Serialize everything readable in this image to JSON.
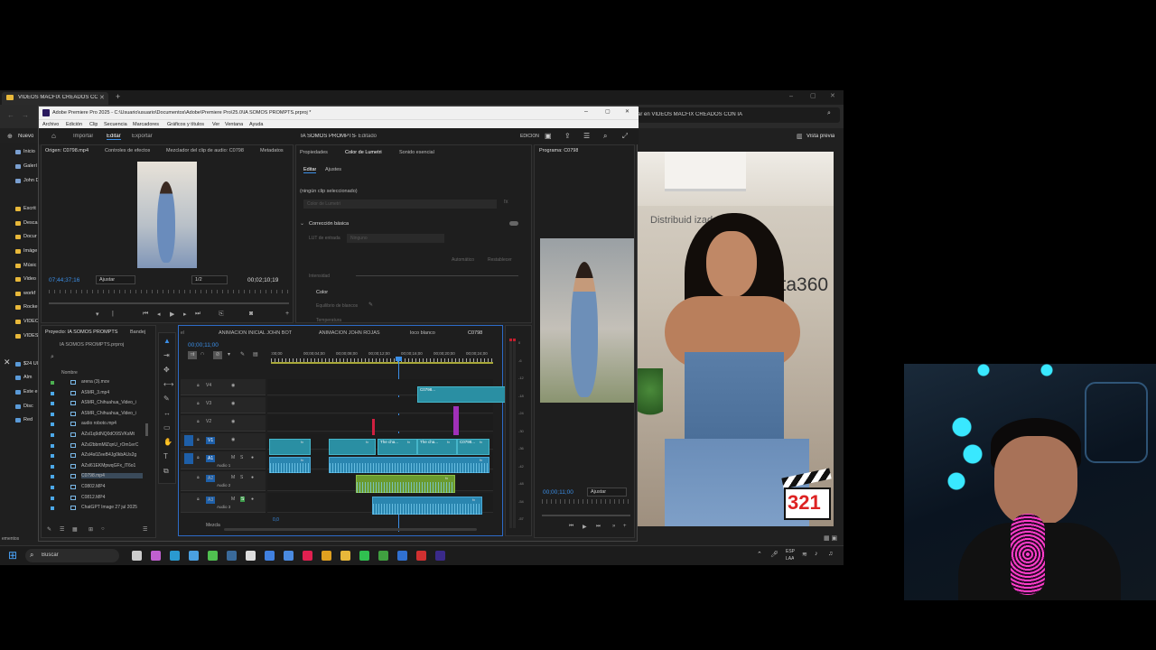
{
  "browser": {
    "tab_title": "VIDEOS MACFIX CREADOS CO",
    "search_text": "ar en VIDEOS MACFIX CREADOS CON IA",
    "preview_label": "Vista previa",
    "new_label": "Nuevo",
    "sidebar": [
      "Inicio",
      "Galerí",
      "John D",
      "Escrit",
      "Desca",
      "Docur",
      "Imáge",
      "Músic",
      "Video",
      "workf",
      "Rocke",
      "VIDEO",
      "VIDES",
      "$24 Ul",
      "Alm",
      "Este e",
      "Disc",
      "Red"
    ],
    "status_left": "ementos"
  },
  "premiere": {
    "window_title": "Adobe Premiere Pro 2025 - C:\\Usuario\\usuario\\Documentos\\Adobe\\Premiere Pro\\25.0\\IA SOMOS PROMPTS.prproj *",
    "menu": [
      "Archivo",
      "Edición",
      "Clip",
      "Secuencia",
      "Marcadores",
      "Gráficos y títulos",
      "Ver",
      "Ventana",
      "Ayuda"
    ],
    "header_tabs": [
      "Importar",
      "Editar",
      "Exportar"
    ],
    "project_title": "IA SOMOS PROMPTS",
    "project_status": "- Editado",
    "workspace_label": "EDICIÓN",
    "source": {
      "tabs": [
        "Origen: C0798.mp4",
        "Controles de efectos",
        "Mezclador del clip de audio: C0798",
        "Metadatos"
      ],
      "timecode": "07;44;37;16",
      "fit": "Ajustar",
      "ratio": "1/2",
      "duration": "00;02;10;19"
    },
    "lumetri": {
      "tabs": [
        "Propiedades",
        "Color de Lumetri",
        "Sonido esencial"
      ],
      "subtabs": [
        "Editar",
        "Ajustes"
      ],
      "no_clip": "(ningún clip seleccionado)",
      "dropdown": "Color de Lumetri",
      "section_basic": "Corrección básica",
      "lut_label": "LUT de entrada",
      "lut_value": "Ninguno",
      "auto": "Automático",
      "reset": "Restablecer",
      "intensity": "Intensidad",
      "color_section": "Color",
      "wb": "Equilibrio de blancos",
      "temp": "Temperatura"
    },
    "program": {
      "tab": "Programa: C0798",
      "timecode": "00;00;11;00",
      "fit": "Ajustar"
    },
    "project": {
      "tabs": [
        "Proyecto: IA SOMOS PROMPTS",
        "Bandej"
      ],
      "file": "IA SOMOS PROMPTS.prproj",
      "col": "Nombre",
      "items": [
        "arena (3).mov",
        "ASMR_3.mp4",
        "ASMR_Chihuahua_Video_i",
        "ASMR_Chihuahua_Video_i",
        "audio roboto.mp4",
        "AZsl1q9dNQ0dO9SVKsMt",
        "AZsl2bbmMlZqnU_rOm1erC",
        "AZsl4s0ZeeB4Jg0kbAUs2g",
        "AZsl61EKMpwqGFx_lT6o1",
        "C0798.mp4",
        "C0802.MP4",
        "C0812.MP4",
        "ChatGPT Image 27 jul 2025"
      ]
    },
    "timeline": {
      "tabs": [
        "ANIMACION INICIAL JOHN BOT",
        "ANIMACION JOHN ROJAS",
        "loco blanco",
        "C0798"
      ],
      "timecode": "00;00;11;00",
      "ruler": [
        ":00;00",
        "00;00;04;00",
        "00;00;08;00",
        "00;00;12;00",
        "00;00;16;00",
        "00;00;20;00",
        "00;00;24;00"
      ],
      "tracks_v": [
        "V4",
        "V3",
        "V2",
        "V1"
      ],
      "tracks_a": [
        "A1",
        "A2",
        "A3"
      ],
      "audio_names": [
        "Audio 1",
        "Audio 2",
        "Audio 3"
      ],
      "mix": "Mezcla",
      "mix_val": "0,0",
      "clip_labels": [
        "C0798...",
        "C0798.m...",
        "The cha...",
        "The cha...",
        "C0798..."
      ],
      "meter": [
        "0",
        "-6",
        "-12",
        "-18",
        "-24",
        "-30",
        "-36",
        "-42",
        "-48",
        "-54",
        "-57"
      ]
    }
  },
  "video_overlay": {
    "sign_text": "Distribuid      izado",
    "brand": "sta360",
    "logo": "321"
  },
  "taskbar": {
    "search": "Buscar",
    "lang": "ESP",
    "lang2": "LAA"
  },
  "colors": {
    "accent": "#3b8fe8",
    "video_clip": "#2a8fa3",
    "audio_clip": "#2a86b0"
  }
}
